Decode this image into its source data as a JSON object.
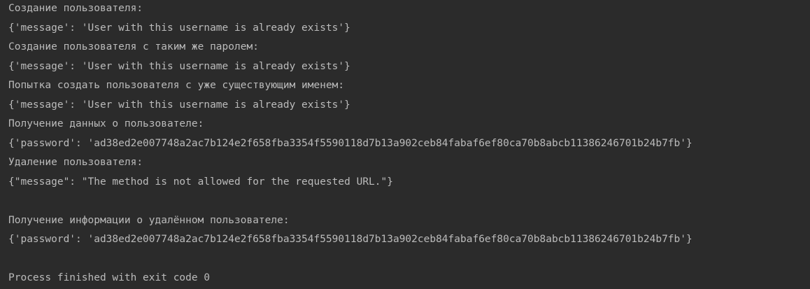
{
  "console": {
    "lines": [
      "Создание пользователя:",
      "{'message': 'User with this username is already exists'}",
      "Создание пользователя с таким же паролем:",
      "{'message': 'User with this username is already exists'}",
      "Попытка создать пользователя с уже существующим именем:",
      "{'message': 'User with this username is already exists'}",
      "Получение данных о пользователе:",
      "{'password': 'ad38ed2e007748a2ac7b124e2f658fba3354f5590118d7b13a902ceb84fabaf6ef80ca70b8abcb11386246701b24b7fb'}",
      "Удаление пользователя:",
      "{\"message\": \"The method is not allowed for the requested URL.\"}",
      "",
      "Получение информации о удалённом пользователе:",
      "{'password': 'ad38ed2e007748a2ac7b124e2f658fba3354f5590118d7b13a902ceb84fabaf6ef80ca70b8abcb11386246701b24b7fb'}",
      "",
      "Process finished with exit code 0"
    ]
  },
  "colors": {
    "background": "#2b2b2b",
    "text": "#bbbbbb"
  }
}
